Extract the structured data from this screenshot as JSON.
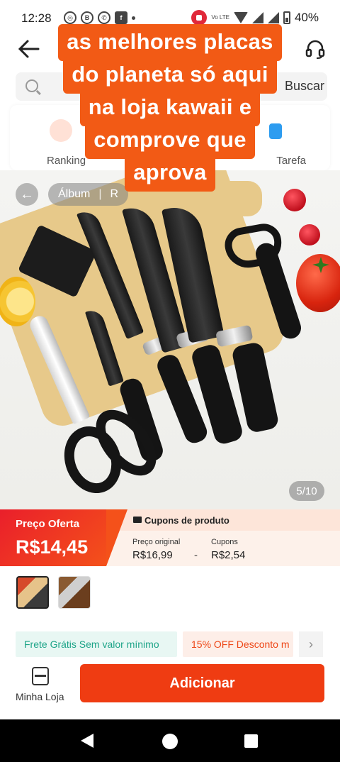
{
  "status_bar": {
    "time": "12:28",
    "volte": "Vo LTE",
    "battery": "40%"
  },
  "header": {
    "back_icon": "back-arrow-icon",
    "headset_icon": "headset-icon"
  },
  "search": {
    "button_label": "Buscar"
  },
  "quick_links": {
    "left_label": "Ranking",
    "right_label": "Tarefa"
  },
  "album": {
    "tab_album": "Álbum",
    "tab_second": "R"
  },
  "caption": {
    "lines": [
      "as melhores placas",
      "do planeta só aqui",
      "na loja kawaii e",
      "comprove que",
      "aprova"
    ]
  },
  "gallery": {
    "counter": "5/10"
  },
  "price": {
    "label": "Preço Oferta",
    "value": "R$14,45"
  },
  "coupons": {
    "title": "Cupons de produto",
    "original_label": "Preço original",
    "original_value": "R$16,99",
    "minus": "-",
    "coupon_label": "Cupons",
    "coupon_value": "R$2,54"
  },
  "tags": {
    "free_shipping": "Frete Grátis Sem valor mínimo",
    "discount": "15% OFF Desconto m",
    "more": "›"
  },
  "bottom_bar": {
    "store_label": "Minha Loja",
    "add_label": "Adicionar"
  },
  "colors": {
    "accent": "#ef3c12",
    "caption_bg": "#f25a15",
    "free_tag": "#1da488"
  }
}
